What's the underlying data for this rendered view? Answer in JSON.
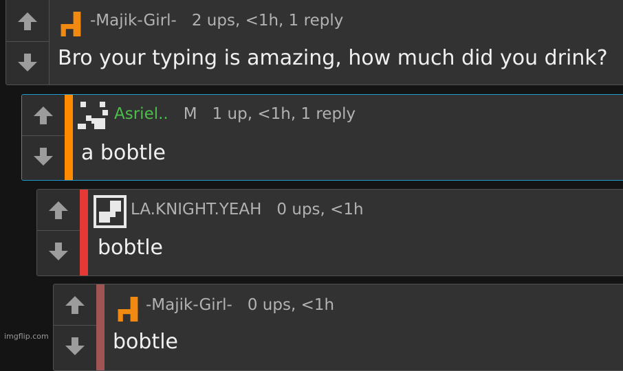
{
  "comments": [
    {
      "username": "-Majik-Girl-",
      "mod_badge": "",
      "stats": "2 ups, <1h, 1 reply",
      "text": "Bro your typing is amazing, how much did you drink?",
      "stripe_color": "",
      "avatar_icon": "orange-block-avatar-icon"
    },
    {
      "username": "Asriel..",
      "mod_badge": "M",
      "stats": "1 up, <1h, 1 reply",
      "text": "a bobtle",
      "stripe_color": "#ff8a00",
      "avatar_icon": "pixel-face-avatar-icon"
    },
    {
      "username": "LA.KNIGHT.YEAH",
      "mod_badge": "",
      "stats": "0 ups, <1h",
      "text": "bobtle",
      "stripe_color": "#e53935",
      "avatar_icon": "pixel-square-avatar-icon"
    },
    {
      "username": "-Majik-Girl-",
      "mod_badge": "",
      "stats": "0 ups, <1h",
      "text": "bobtle",
      "stripe_color": "#a05555",
      "avatar_icon": "orange-block-avatar-icon"
    }
  ],
  "watermark": "imgflip.com",
  "colors": {
    "background": "#141414",
    "card": "#323232",
    "highlight_border": "#1f9bd3",
    "username_green": "#4bbf4a"
  }
}
